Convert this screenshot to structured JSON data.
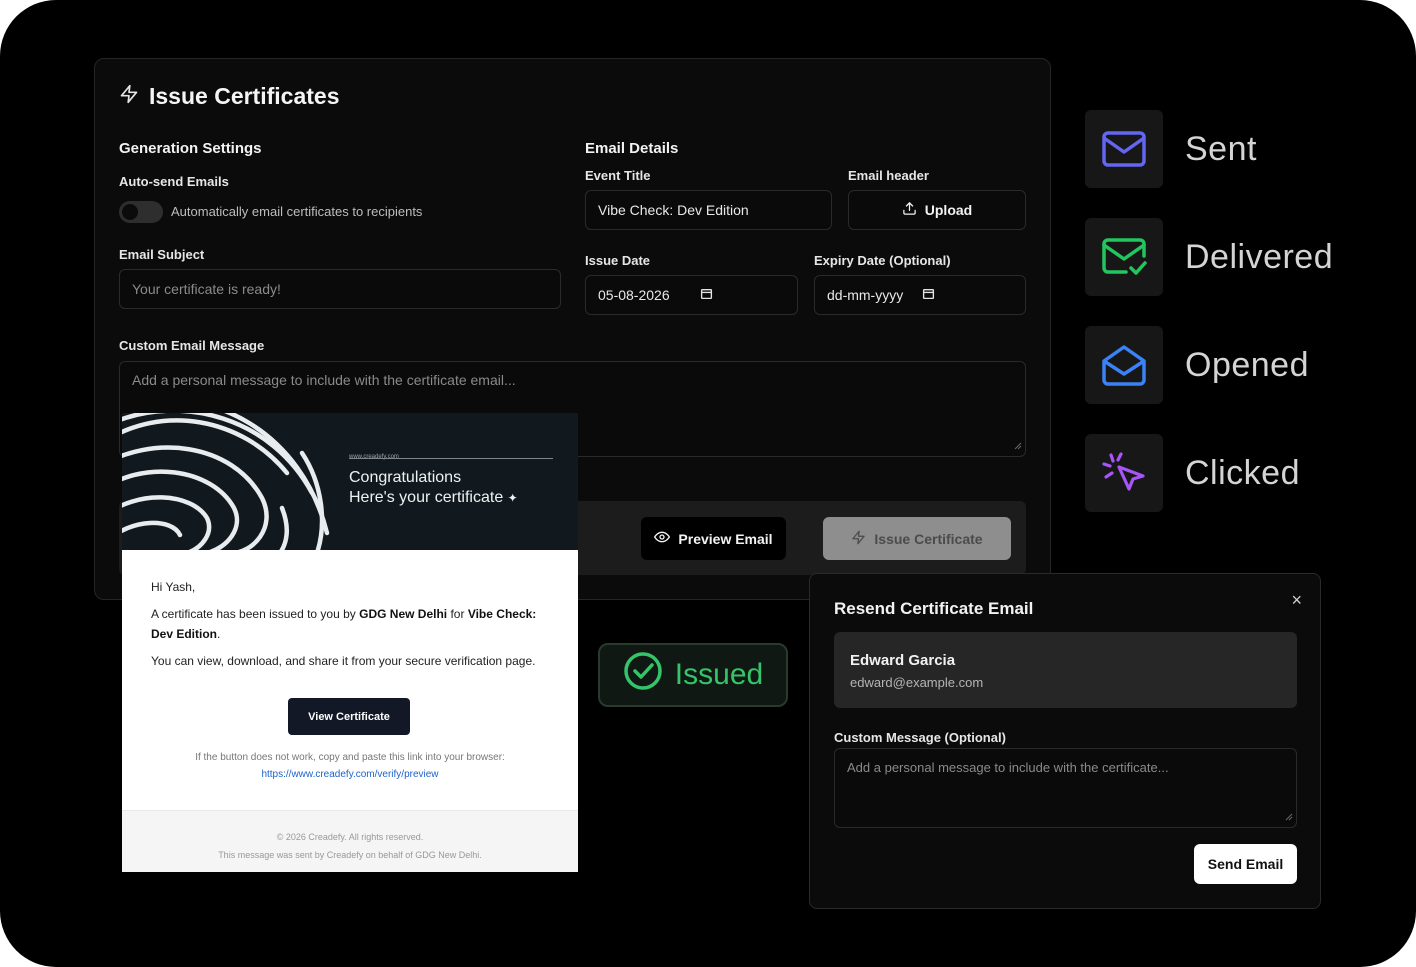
{
  "issue_panel": {
    "title": "Issue Certificates",
    "generation": {
      "heading": "Generation Settings",
      "auto_send_label": "Auto-send Emails",
      "auto_send_desc": "Automatically email certificates to recipients",
      "auto_send_enabled": false,
      "subject_label": "Email Subject",
      "subject_placeholder": "Your certificate is ready!"
    },
    "email_details": {
      "heading": "Email Details",
      "event_title_label": "Event Title",
      "event_title_value": "Vibe Check: Dev Edition",
      "email_header_label": "Email header",
      "upload_label": "Upload",
      "issue_date_label": "Issue Date",
      "issue_date_value": "05-08-2026",
      "expiry_date_label": "Expiry Date (Optional)",
      "expiry_date_placeholder": "dd-mm-yyyy"
    },
    "custom_message_label": "Custom Email Message",
    "custom_message_placeholder": "Add a personal message to include with the certificate email...",
    "preview_button": "Preview Email",
    "issue_button": "Issue Certificate"
  },
  "statuses": [
    {
      "label": "Sent",
      "icon": "mail-icon",
      "color": "#6366f1"
    },
    {
      "label": "Delivered",
      "icon": "mail-check-icon",
      "color": "#22c55e"
    },
    {
      "label": "Opened",
      "icon": "mail-open-icon",
      "color": "#3b82f6"
    },
    {
      "label": "Clicked",
      "icon": "mouse-pointer-click-icon",
      "color": "#a855f7"
    }
  ],
  "email_preview": {
    "site": "www.creadefy.com",
    "banner_line1": "Congratulations",
    "banner_line2": "Here's your certificate",
    "greeting": "Hi Yash,",
    "body_prefix": "A certificate has been issued to you by ",
    "issuer": "GDG New Delhi",
    "body_mid": " for ",
    "event": "Vibe Check: Dev Edition",
    "body_suffix": ".",
    "body_line2": "You can view, download, and share it from your secure verification page.",
    "button": "View Certificate",
    "fallback_text": "If the button does not work, copy and paste this link into your browser:",
    "fallback_link": "https://www.creadefy.com/verify/preview",
    "footer_copyright": "© 2026 Creadefy. All rights reserved.",
    "footer_note": "This message was sent by Creadefy on behalf of GDG New Delhi."
  },
  "issued_badge": {
    "label": "Issued",
    "color": "#35c46a"
  },
  "resend_dialog": {
    "title": "Resend Certificate Email",
    "close_label": "×",
    "recipient_name": "Edward Garcia",
    "recipient_email": "edward@example.com",
    "message_label": "Custom Message (Optional)",
    "message_placeholder": "Add a personal message to include with the certificate...",
    "send_button": "Send Email"
  }
}
